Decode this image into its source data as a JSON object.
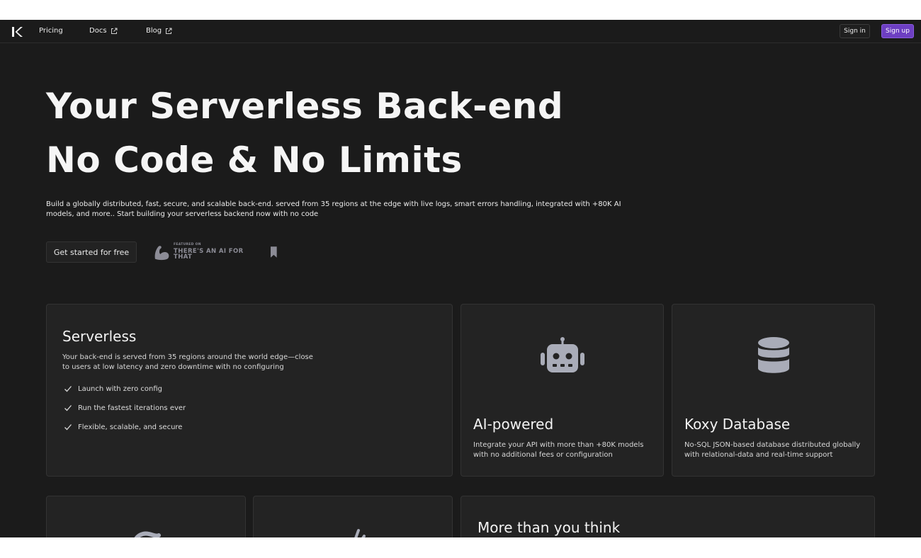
{
  "nav": {
    "links": [
      {
        "label": "Pricing",
        "external": false
      },
      {
        "label": "Docs",
        "external": true
      },
      {
        "label": "Blog",
        "external": true
      }
    ],
    "sign_in": "Sign in",
    "sign_up": "Sign up"
  },
  "hero": {
    "title_line1": "Your Serverless Back-end",
    "title_line2": "No Code & No Limits",
    "description": "Build a globally distributed, fast, secure, and scalable back-end. served from 35 regions at the edge with live logs, smart errors handling, integrated with +80K AI models, and more.. Start building your serverless backend now with no code",
    "cta": "Get started for free",
    "badge_small": "FEATURED ON",
    "badge_big": "THERE'S AN AI FOR THAT"
  },
  "cards": {
    "serverless": {
      "title": "Serverless",
      "description": "Your back-end is served from 35 regions around the world edge—close to users at low latency and zero downtime with no configuring",
      "features": [
        "Launch with zero config",
        "Run the fastest iterations ever",
        "Flexible, scalable, and secure"
      ]
    },
    "ai": {
      "icon": "robot-icon",
      "title": "AI-powered",
      "description": "Integrate your API with more than +80K models with no additional fees or configuration"
    },
    "database": {
      "icon": "database-icon",
      "title": "Koxy Database",
      "description": "No-SQL JSON-based database distributed globally with relational-data and real-time support"
    },
    "more": {
      "title": "More than you think"
    }
  },
  "colors": {
    "background": "#1b1b1b",
    "card": "#232323",
    "accent": "#6d3fc2",
    "icon_gray": "#a9acb8"
  }
}
